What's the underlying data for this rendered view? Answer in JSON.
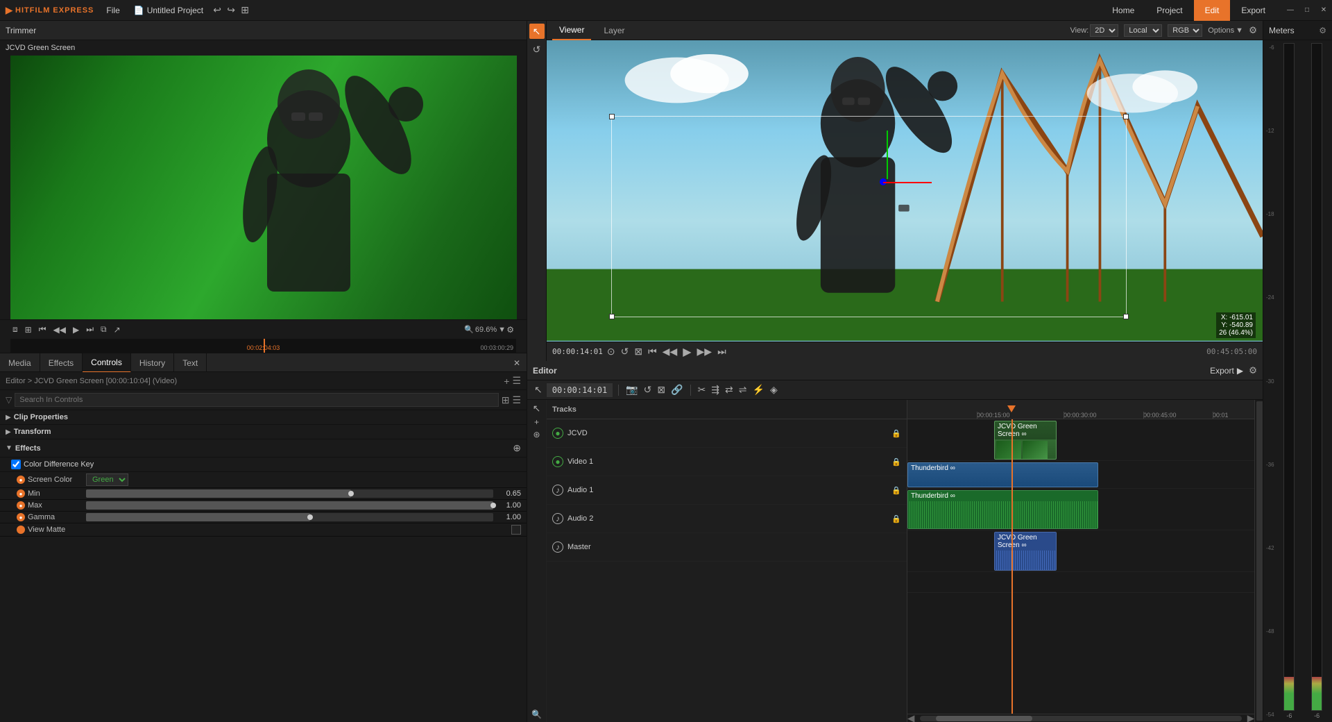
{
  "app": {
    "name": "HITFILM EXPRESS",
    "logo_symbol": "▶",
    "accent_color": "#e8732a"
  },
  "titlebar": {
    "menu_items": [
      "File",
      "Untitled Project",
      "↩",
      "↪",
      "⊞"
    ],
    "file_label": "File",
    "project_label": "Untitled Project",
    "nav_home": "Home",
    "nav_project": "Project",
    "nav_edit": "Edit",
    "nav_export": "Export",
    "win_min": "—",
    "win_max": "□",
    "win_close": "✕"
  },
  "trimmer": {
    "title": "Trimmer",
    "clip_name": "JCVD Green Screen",
    "zoom_level": "69.6%",
    "timecode": "00:02:04:03",
    "end_timecode": "00:03:00:29"
  },
  "panel_tabs": {
    "media": "Media",
    "effects": "Effects",
    "controls": "Controls",
    "history": "History",
    "text": "Text"
  },
  "controls_panel": {
    "editor_breadcrumb": "Editor > JCVD Green Screen [00:00:10:04] (Video)",
    "search_placeholder": "Search In Controls",
    "clip_properties_label": "Clip Properties",
    "transform_label": "Transform",
    "effects_label": "Effects",
    "color_diff_key_label": "Color Difference Key",
    "screen_color_label": "Screen Color",
    "screen_color_value": "Green",
    "min_label": "Min",
    "min_value": "0.65",
    "min_slider_pct": 65,
    "max_label": "Max",
    "max_value": "1.00",
    "max_slider_pct": 100,
    "gamma_label": "Gamma",
    "gamma_value": "1.00",
    "gamma_slider_pct": 55,
    "view_matte_label": "View Matte"
  },
  "viewer": {
    "title": "Viewer",
    "tab_viewer": "Viewer",
    "tab_layer": "Layer",
    "view_mode": "2D",
    "space": "Local",
    "channels": "RGB",
    "options": "Options",
    "timecode": "00:00:14:01",
    "end_timecode": "00:45:05:00",
    "coords_x": "X: -615.01",
    "coords_y": "Y: -540.89",
    "zoom_label": "26 (46.4%)"
  },
  "editor": {
    "title": "Editor",
    "export_label": "Export",
    "timecode": "00:00:14:01",
    "tracks_label": "Tracks",
    "tracks": [
      {
        "name": "JCVD",
        "type": "video-top",
        "icon": "eye-icon"
      },
      {
        "name": "Video 1",
        "type": "video",
        "icon": "eye-icon"
      },
      {
        "name": "Audio 1",
        "type": "audio",
        "icon": "speaker-icon"
      },
      {
        "name": "Audio 2",
        "type": "audio",
        "icon": "speaker-icon"
      },
      {
        "name": "Master",
        "type": "master",
        "icon": "speaker-icon"
      }
    ],
    "ruler_marks": [
      "00:00:15:00",
      "00:00:30:00",
      "00:00:45:00",
      "00:01"
    ],
    "clips": [
      {
        "id": "jcvd-clip",
        "name": "JCVD Green Screen",
        "track": 0,
        "type": "video-green",
        "left_pct": 25,
        "width_pct": 18
      },
      {
        "id": "thunder-video",
        "name": "Thunderbird",
        "track": 1,
        "type": "video-blue",
        "left_pct": 0,
        "width_pct": 55
      },
      {
        "id": "thunder-audio",
        "name": "Thunderbird",
        "track": 2,
        "type": "audio-green",
        "left_pct": 0,
        "width_pct": 55
      },
      {
        "id": "jcvd-audio",
        "name": "JCVD Green Screen",
        "track": 3,
        "type": "audio-blue",
        "left_pct": 25,
        "width_pct": 18
      }
    ],
    "playhead_pct": 30
  },
  "meters": {
    "title": "Meters",
    "left_label": "-6",
    "right_label": "-6",
    "scale": [
      "-6",
      "-12",
      "-18",
      "-24",
      "-30",
      "-36",
      "-42",
      "-48",
      "-54"
    ]
  },
  "toolbar": {
    "tools": [
      "↖",
      "↺"
    ]
  }
}
